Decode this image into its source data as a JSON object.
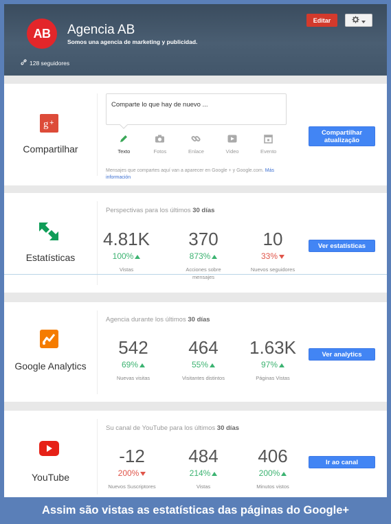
{
  "header": {
    "avatar_text": "AB",
    "name": "Agencia AB",
    "tagline": "Somos una agencia de marketing y publicidad.",
    "followers": "128 seguidores",
    "edit_label": "Editar"
  },
  "share": {
    "label": "Compartilhar",
    "placeholder": "Comparte lo que hay de nuevo ...",
    "tools": [
      "Texto",
      "Fotos",
      "Enlace",
      "Video",
      "Evento"
    ],
    "note": "Mensajes que compartes aquí van a aparecer en Google + y Google.com.",
    "note_link": "Más información",
    "button": "Compartilhar atualização"
  },
  "stats": {
    "label": "Estatísticas",
    "title_prefix": "Perspectivas para los últimos",
    "title_bold": "30 días",
    "button": "Ver estatísticas",
    "items": [
      {
        "value": "4.81K",
        "pct": "100%",
        "trend": "up",
        "caption": "Vistas"
      },
      {
        "value": "370",
        "pct": "873%",
        "trend": "up",
        "caption": "Acciones sobre mensajes"
      },
      {
        "value": "10",
        "pct": "33%",
        "trend": "down",
        "caption": "Nuevos seguidores"
      }
    ]
  },
  "analytics": {
    "label": "Google Analytics",
    "title_prefix": "Agencia durante los últimos",
    "title_bold": "30 días",
    "button": "Ver analytics",
    "items": [
      {
        "value": "542",
        "pct": "69%",
        "trend": "up",
        "caption": "Nuevas visitas"
      },
      {
        "value": "464",
        "pct": "55%",
        "trend": "up",
        "caption": "Visitantes distintos"
      },
      {
        "value": "1.63K",
        "pct": "97%",
        "trend": "up",
        "caption": "Páginas Vistas"
      }
    ]
  },
  "youtube": {
    "label": "YouTube",
    "title_prefix": "Su canal de YouTube para los últimos",
    "title_bold": "30 días",
    "button": "Ir ao canal",
    "items": [
      {
        "value": "-12",
        "pct": "200%",
        "trend": "down",
        "caption": "Nuevos Suscriptores"
      },
      {
        "value": "484",
        "pct": "214%",
        "trend": "up",
        "caption": "Vistas"
      },
      {
        "value": "406",
        "pct": "200%",
        "trend": "up",
        "caption": "Minutos vistos"
      }
    ]
  },
  "caption": "Assim são vistas as estatísticas das páginas do Google+",
  "colors": {
    "accent_red": "#d33a2c",
    "button_blue": "#4285f4",
    "up_green": "#3cb371",
    "down_red": "#e0554a",
    "frame_blue": "#5a7fb8"
  }
}
